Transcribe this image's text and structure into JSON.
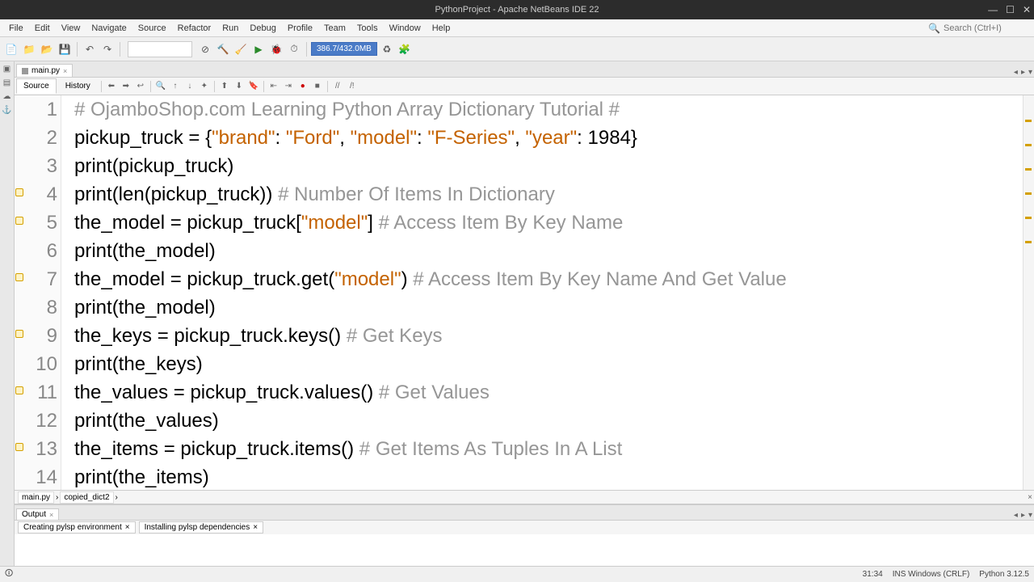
{
  "window": {
    "title": "PythonProject - Apache NetBeans IDE 22"
  },
  "menu": {
    "items": [
      "File",
      "Edit",
      "View",
      "Navigate",
      "Source",
      "Refactor",
      "Run",
      "Debug",
      "Profile",
      "Team",
      "Tools",
      "Window",
      "Help"
    ]
  },
  "search": {
    "placeholder": "Search (Ctrl+I)"
  },
  "toolbar": {
    "memory": "386.7/432.0MB"
  },
  "file_tabs": {
    "active": "main.py"
  },
  "sub_tabs": {
    "items": [
      "Source",
      "History"
    ],
    "active": "Source"
  },
  "code": {
    "lines": [
      {
        "n": 1,
        "anno": false,
        "segments": [
          {
            "t": "# OjamboShop.com Learning Python Array Dictionary Tutorial #",
            "c": "c-comment"
          }
        ]
      },
      {
        "n": 2,
        "anno": false,
        "segments": [
          {
            "t": "pickup_truck = {",
            "c": ""
          },
          {
            "t": "\"brand\"",
            "c": "c-string"
          },
          {
            "t": ": ",
            "c": ""
          },
          {
            "t": "\"Ford\"",
            "c": "c-string"
          },
          {
            "t": ", ",
            "c": ""
          },
          {
            "t": "\"model\"",
            "c": "c-string"
          },
          {
            "t": ": ",
            "c": ""
          },
          {
            "t": "\"F-Series\"",
            "c": "c-string"
          },
          {
            "t": ", ",
            "c": ""
          },
          {
            "t": "\"year\"",
            "c": "c-string"
          },
          {
            "t": ": 1984}",
            "c": ""
          }
        ]
      },
      {
        "n": 3,
        "anno": false,
        "segments": [
          {
            "t": "print(pickup_truck)",
            "c": ""
          }
        ]
      },
      {
        "n": 4,
        "anno": true,
        "segments": [
          {
            "t": "print(len(pickup_truck)) ",
            "c": ""
          },
          {
            "t": "# Number Of Items In Dictionary",
            "c": "c-comment"
          }
        ]
      },
      {
        "n": 5,
        "anno": true,
        "segments": [
          {
            "t": "the_model = pickup_truck[",
            "c": ""
          },
          {
            "t": "\"model\"",
            "c": "c-string"
          },
          {
            "t": "] ",
            "c": ""
          },
          {
            "t": "# Access Item By Key Name",
            "c": "c-comment"
          }
        ]
      },
      {
        "n": 6,
        "anno": false,
        "segments": [
          {
            "t": "print(the_model)",
            "c": ""
          }
        ]
      },
      {
        "n": 7,
        "anno": true,
        "segments": [
          {
            "t": "the_model = pickup_truck.get(",
            "c": ""
          },
          {
            "t": "\"model\"",
            "c": "c-string"
          },
          {
            "t": ") ",
            "c": ""
          },
          {
            "t": "# Access Item By Key Name And Get Value",
            "c": "c-comment"
          }
        ]
      },
      {
        "n": 8,
        "anno": false,
        "segments": [
          {
            "t": "print(the_model)",
            "c": ""
          }
        ]
      },
      {
        "n": 9,
        "anno": true,
        "segments": [
          {
            "t": "the_keys = pickup_truck.keys() ",
            "c": ""
          },
          {
            "t": "# Get Keys",
            "c": "c-comment"
          }
        ]
      },
      {
        "n": 10,
        "anno": false,
        "segments": [
          {
            "t": "print(the_keys)",
            "c": ""
          }
        ]
      },
      {
        "n": 11,
        "anno": true,
        "segments": [
          {
            "t": "the_values = pickup_truck.values() ",
            "c": ""
          },
          {
            "t": "# Get Values",
            "c": "c-comment"
          }
        ]
      },
      {
        "n": 12,
        "anno": false,
        "segments": [
          {
            "t": "print(the_values)",
            "c": ""
          }
        ]
      },
      {
        "n": 13,
        "anno": true,
        "segments": [
          {
            "t": "the_items = pickup_truck.items() ",
            "c": ""
          },
          {
            "t": "# Get Items As Tuples In A List",
            "c": "c-comment"
          }
        ]
      },
      {
        "n": 14,
        "anno": false,
        "segments": [
          {
            "t": "print(the_items)",
            "c": ""
          }
        ]
      }
    ]
  },
  "breadcrumbs": {
    "items": [
      "main.py",
      "copied_dict2"
    ]
  },
  "output": {
    "tab": "Output",
    "subtabs": [
      "Creating pylsp environment",
      "Installing pylsp dependencies"
    ]
  },
  "status": {
    "cursor": "31:34",
    "encoding": "INS Windows (CRLF)",
    "python": "Python 3.12.5"
  },
  "left_tabs": [
    "Projects",
    "Files",
    "Services",
    "Navigator"
  ]
}
